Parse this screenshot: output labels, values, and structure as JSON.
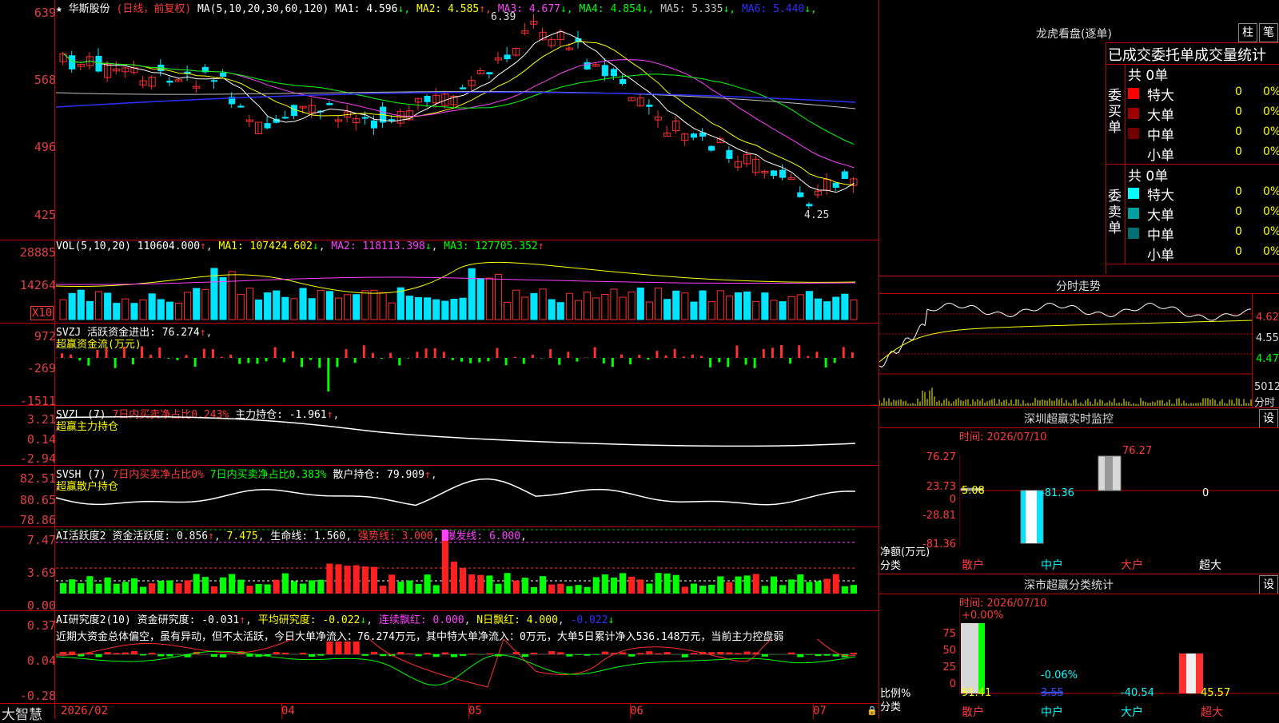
{
  "main": {
    "star": "★",
    "name": "华斯股份",
    "mode": "(日线，前复权)",
    "ma_def": "MA(5,10,20,30,60,120)",
    "ma": [
      {
        "label": "MA1:",
        "value": "4.596",
        "arrow": "↓",
        "color": "#ffffff"
      },
      {
        "label": "MA2:",
        "value": "4.585",
        "arrow": "↑",
        "color": "#ffff00"
      },
      {
        "label": "MA3:",
        "value": "4.677",
        "arrow": "↓",
        "color": "#ff40ff"
      },
      {
        "label": "MA4:",
        "value": "4.854",
        "arrow": "↓",
        "color": "#00ff00"
      },
      {
        "label": "MA5:",
        "value": "5.335",
        "arrow": "↓",
        "color": "#c0c0c0"
      },
      {
        "label": "MA6:",
        "value": "5.440",
        "arrow": "↓",
        "color": "#3030ff"
      }
    ],
    "y_ticks": [
      "639",
      "568",
      "496",
      "425"
    ],
    "high": "6.39",
    "low": "4.25"
  },
  "vol": {
    "title": "VOL(5,10,20)",
    "value": "110604.000",
    "ma1": "MA1: 107424.602",
    "ma2": "MA2: 118113.398",
    "ma3": "MA3: 127705.352",
    "y_ticks": [
      "28885",
      "14264"
    ],
    "unit": "X10"
  },
  "svzj": {
    "title": "SVZJ",
    "l1": "活跃资金进出: 76.274",
    "l2": "超赢资金流(万元)",
    "y_ticks": [
      "972",
      "-269",
      "-1511"
    ]
  },
  "svzl": {
    "title": "SVZL (7)",
    "a": "7日内买卖净占比0.243%",
    "b": "主力持仓: -1.961",
    "l2": "超赢主力持仓",
    "y_ticks": [
      "3.21",
      "0.14",
      "-2.94"
    ]
  },
  "svsh": {
    "title": "SVSH (7)",
    "a": "7日内买卖净占比0%",
    "b": "7日内买卖净占比0.383%",
    "c": "散户持仓: 79.909",
    "l2": "超赢散户持仓",
    "y_ticks": [
      "82.51",
      "80.65",
      "78.86"
    ]
  },
  "ai1": {
    "title": "AI活跃度2",
    "a": "资金活跃度: 0.856",
    "b": "7.475",
    "c": "生命线: 1.560",
    "d": "强势线: 3.000",
    "e": "爆发线: 6.000",
    "y_ticks": [
      "7.47",
      "3.69",
      "0.00"
    ]
  },
  "ai2": {
    "title": "AI研究度2(10)",
    "a": "资金研究度: -0.031",
    "b": "平均研究度: -0.022",
    "c": "连续飘红: 0.000",
    "d": "N日飘红: 4.000",
    "e": "-0.022",
    "text": "近期大资金总体偏空，虽有异动，但不太活跃，今日大单净流入：76.274万元，其中特大单净流入：0万元，大单5日累计净入536.148万元，当前主力控盘弱",
    "y_ticks": [
      "0.37",
      "0.04",
      "-0.28"
    ]
  },
  "bottom": {
    "brand": "大智慧",
    "dates": [
      "2026/02",
      "04",
      "05",
      "06",
      "07"
    ]
  },
  "lhb": {
    "title": "龙虎看盘(逐单)",
    "btn1": "柱",
    "btn2": "笔",
    "subtitle": "已成交委托单成交量统计",
    "buy_label": "委买单",
    "sell_label": "委卖单",
    "buy_total": "共 0单",
    "sell_total": "共 0单",
    "buy_rows": [
      {
        "name": "特大",
        "count": "0",
        "pct": "0%",
        "color": "#ff0000"
      },
      {
        "name": "大单",
        "count": "0",
        "pct": "0%",
        "color": "#a00000"
      },
      {
        "name": "中单",
        "count": "0",
        "pct": "0%",
        "color": "#700000"
      },
      {
        "name": "小单",
        "count": "0",
        "pct": "0%",
        "color": "#000000"
      }
    ],
    "sell_rows": [
      {
        "name": "特大",
        "count": "0",
        "pct": "0%",
        "color": "#00ffff"
      },
      {
        "name": "大单",
        "count": "0",
        "pct": "0%",
        "color": "#00a0a0"
      },
      {
        "name": "中单",
        "count": "0",
        "pct": "0%",
        "color": "#007070"
      },
      {
        "name": "小单",
        "count": "0",
        "pct": "0%",
        "color": "#000000"
      }
    ]
  },
  "intraday": {
    "title": "分时走势",
    "y_ticks": [
      "4.625",
      "4.550",
      "4.475"
    ],
    "vol_label": "5012",
    "vol_unit": "分时"
  },
  "sz_monitor": {
    "title": "深圳超赢实时监控",
    "set": "设",
    "time": "时间: 2026/07/10",
    "y_ticks": [
      "76.27",
      "23.73",
      "0",
      "-28.81",
      "-81.36"
    ],
    "axis_label1": "净额(万元)",
    "axis_label2": "分类",
    "categories": [
      "散户",
      "中户",
      "大户",
      "超大"
    ],
    "values": [
      5.08,
      -81.36,
      76.27,
      0
    ],
    "value_labels": [
      "5.08",
      "-81.36",
      "76.27",
      "0"
    ]
  },
  "sz_class": {
    "title": "深市超赢分类统计",
    "set": "设",
    "time": "时间: 2026/07/10",
    "y_ticks": [
      "75",
      "50",
      "25",
      "0"
    ],
    "axis_label1": "比例%",
    "axis_label2": "分类",
    "categories": [
      "散户",
      "中户",
      "大户",
      "超大"
    ],
    "top_labels": [
      "+0.00%",
      "-0.06%"
    ],
    "bottom_labels": [
      "91.41",
      "3.55",
      "-40.54",
      "45.57"
    ]
  }
}
